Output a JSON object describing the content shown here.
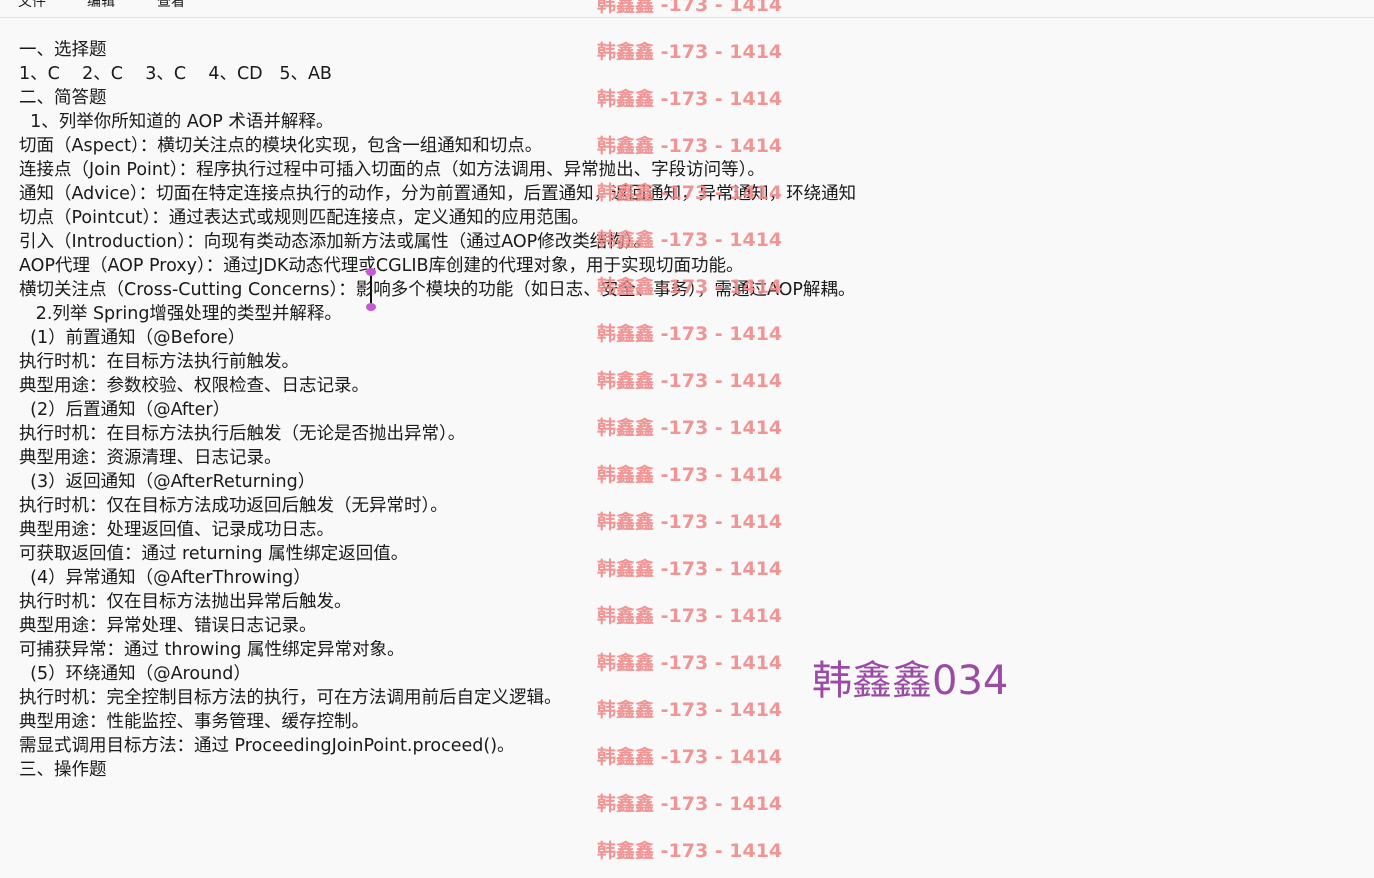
{
  "menu": {
    "items": [
      "文件",
      "编辑",
      "查看"
    ]
  },
  "document": {
    "lines": [
      "一、选择题",
      "1、C    2、C    3、C    4、CD   5、AB",
      "二、简答题",
      "  1、列举你所知道的 AOP 术语并解释。",
      "切面（Aspect）：横切关注点的模块化实现，包含一组通知和切点。",
      "连接点（Join Point）：程序执行过程中可插入切面的点（如方法调用、异常抛出、字段访问等）。",
      "通知（Advice）：切面在特定连接点执行的动作，分为前置通知，后置通知，返回通知，异常通知，环绕通知",
      "切点（Pointcut）：通过表达式或规则匹配连接点，定义通知的应用范围。",
      "引入（Introduction）：向现有类动态添加新方法或属性（通过AOP修改类结构）。",
      "AOP代理（AOP Proxy）：通过JDK动态代理或CGLIB库创建的代理对象，用于实现切面功能。",
      "横切关注点（Cross-Cutting Concerns）：影响多个模块的功能（如日志、安全、事务），需通过AOP解耦。",
      "   2.列举 Spring增强处理的类型并解释。",
      "  (1）前置通知（@Before）",
      "执行时机：在目标方法执行前触发。",
      "典型用途：参数校验、权限检查、日志记录。",
      "  (2）后置通知（@After）",
      "执行时机：在目标方法执行后触发（无论是否抛出异常）。",
      "典型用途：资源清理、日志记录。",
      "  (3）返回通知（@AfterReturning）",
      "执行时机：仅在目标方法成功返回后触发（无异常时）。",
      "典型用途：处理返回值、记录成功日志。",
      "可获取返回值：通过 returning 属性绑定返回值。",
      "  (4）异常通知（@AfterThrowing）",
      "执行时机：仅在目标方法抛出异常后触发。",
      "典型用途：异常处理、错误日志记录。",
      "可捕获异常：通过 throwing 属性绑定异常对象。",
      "  (5）环绕通知（@Around）",
      "执行时机：完全控制目标方法的执行，可在方法调用前后自定义逻辑。",
      "典型用途：性能监控、事务管理、缓存控制。",
      "需显式调用目标方法：通过 ProceedingJoinPoint.proceed()。",
      "三、操作题"
    ]
  },
  "watermark": {
    "repeated_text": "韩鑫鑫 -173 - 1414",
    "big_text": "韩鑫鑫034"
  }
}
